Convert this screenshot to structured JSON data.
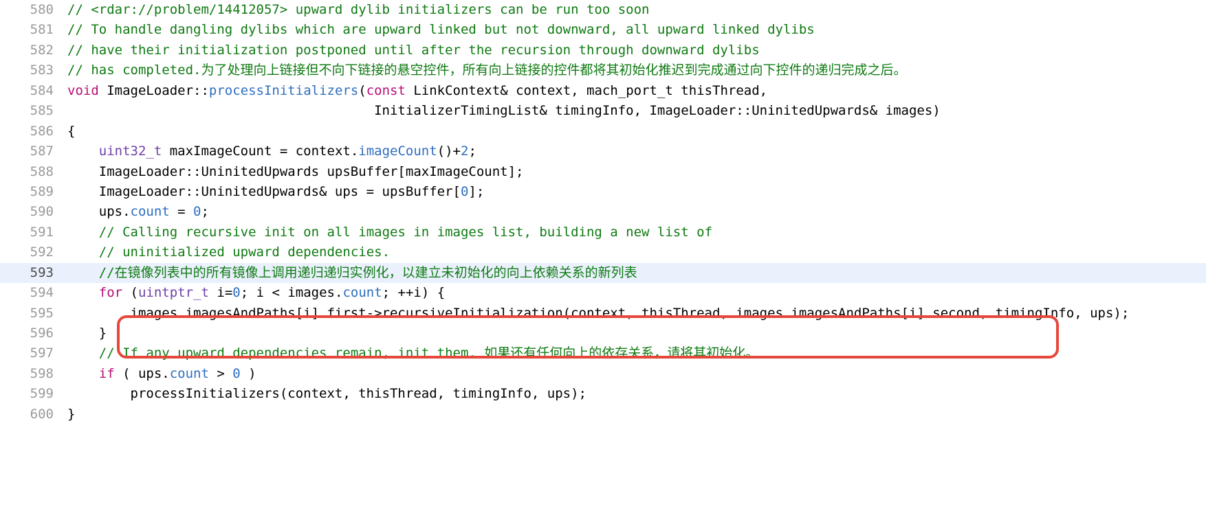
{
  "lines": [
    {
      "num": "580",
      "highlighted": false,
      "tokens": [
        {
          "cls": "tok-comment",
          "t": "// <rdar://problem/14412057> upward dylib initializers can be run too soon"
        }
      ]
    },
    {
      "num": "581",
      "highlighted": false,
      "tokens": [
        {
          "cls": "tok-comment",
          "t": "// To handle dangling dylibs which are upward linked but not downward, all upward linked dylibs"
        }
      ]
    },
    {
      "num": "582",
      "highlighted": false,
      "tokens": [
        {
          "cls": "tok-comment",
          "t": "// have their initialization postponed until after the recursion through downward dylibs"
        }
      ]
    },
    {
      "num": "583",
      "highlighted": false,
      "tokens": [
        {
          "cls": "tok-comment",
          "t": "// has completed.为了处理向上链接但不向下链接的悬空控件，所有向上链接的控件都将其初始化推迟到完成通过向下控件的递归完成之后。"
        }
      ]
    },
    {
      "num": "584",
      "highlighted": false,
      "tokens": [
        {
          "cls": "tok-keyword",
          "t": "void"
        },
        {
          "cls": "tok-plain",
          "t": " ImageLoader::"
        },
        {
          "cls": "tok-member",
          "t": "processInitializers"
        },
        {
          "cls": "tok-plain",
          "t": "("
        },
        {
          "cls": "tok-keyword",
          "t": "const"
        },
        {
          "cls": "tok-plain",
          "t": " LinkContext& context, mach_port_t thisThread,"
        }
      ]
    },
    {
      "num": "585",
      "highlighted": false,
      "tokens": [
        {
          "cls": "tok-plain",
          "t": "                                       InitializerTimingList& timingInfo, ImageLoader::UninitedUpwards& images)"
        }
      ]
    },
    {
      "num": "586",
      "highlighted": false,
      "tokens": [
        {
          "cls": "tok-plain",
          "t": "{"
        }
      ]
    },
    {
      "num": "587",
      "highlighted": false,
      "tokens": [
        {
          "cls": "tok-plain",
          "t": "    "
        },
        {
          "cls": "tok-type",
          "t": "uint32_t"
        },
        {
          "cls": "tok-plain",
          "t": " maxImageCount = context."
        },
        {
          "cls": "tok-member",
          "t": "imageCount"
        },
        {
          "cls": "tok-plain",
          "t": "()+"
        },
        {
          "cls": "tok-number",
          "t": "2"
        },
        {
          "cls": "tok-plain",
          "t": ";"
        }
      ]
    },
    {
      "num": "588",
      "highlighted": false,
      "tokens": [
        {
          "cls": "tok-plain",
          "t": "    ImageLoader::UninitedUpwards upsBuffer[maxImageCount];"
        }
      ]
    },
    {
      "num": "589",
      "highlighted": false,
      "tokens": [
        {
          "cls": "tok-plain",
          "t": "    ImageLoader::UninitedUpwards& ups = upsBuffer["
        },
        {
          "cls": "tok-number",
          "t": "0"
        },
        {
          "cls": "tok-plain",
          "t": "];"
        }
      ]
    },
    {
      "num": "590",
      "highlighted": false,
      "tokens": [
        {
          "cls": "tok-plain",
          "t": "    ups."
        },
        {
          "cls": "tok-member",
          "t": "count"
        },
        {
          "cls": "tok-plain",
          "t": " = "
        },
        {
          "cls": "tok-number",
          "t": "0"
        },
        {
          "cls": "tok-plain",
          "t": ";"
        }
      ]
    },
    {
      "num": "591",
      "highlighted": false,
      "tokens": [
        {
          "cls": "tok-plain",
          "t": "    "
        },
        {
          "cls": "tok-comment",
          "t": "// Calling recursive init on all images in images list, building a new list of"
        }
      ]
    },
    {
      "num": "592",
      "highlighted": false,
      "tokens": [
        {
          "cls": "tok-plain",
          "t": "    "
        },
        {
          "cls": "tok-comment",
          "t": "// uninitialized upward dependencies."
        }
      ]
    },
    {
      "num": "593",
      "highlighted": true,
      "tokens": [
        {
          "cls": "tok-plain",
          "t": "    "
        },
        {
          "cls": "tok-comment",
          "t": "//在镜像列表中的所有镜像上调用递归递归实例化，以建立未初始化的向上依赖关系的新列表"
        }
      ]
    },
    {
      "num": "594",
      "highlighted": false,
      "tokens": [
        {
          "cls": "tok-plain",
          "t": "    "
        },
        {
          "cls": "tok-keyword",
          "t": "for"
        },
        {
          "cls": "tok-plain",
          "t": " ("
        },
        {
          "cls": "tok-type",
          "t": "uintptr_t"
        },
        {
          "cls": "tok-plain",
          "t": " i="
        },
        {
          "cls": "tok-number",
          "t": "0"
        },
        {
          "cls": "tok-plain",
          "t": "; i < images."
        },
        {
          "cls": "tok-member",
          "t": "count"
        },
        {
          "cls": "tok-plain",
          "t": "; ++i) {"
        }
      ]
    },
    {
      "num": "595",
      "highlighted": false,
      "tokens": [
        {
          "cls": "tok-plain",
          "t": "        images.imagesAndPaths[i].first->recursiveInitialization(context, thisThread, images.imagesAndPaths[i].second, timingInfo, ups);"
        }
      ]
    },
    {
      "num": "596",
      "highlighted": false,
      "tokens": [
        {
          "cls": "tok-plain",
          "t": "    }"
        }
      ]
    },
    {
      "num": "597",
      "highlighted": false,
      "tokens": [
        {
          "cls": "tok-plain",
          "t": "    "
        },
        {
          "cls": "tok-comment",
          "t": "// If any upward dependencies remain, init them. 如果还有任何向上的依存关系，请将其初始化。"
        }
      ]
    },
    {
      "num": "598",
      "highlighted": false,
      "tokens": [
        {
          "cls": "tok-plain",
          "t": "    "
        },
        {
          "cls": "tok-keyword",
          "t": "if"
        },
        {
          "cls": "tok-plain",
          "t": " ( ups."
        },
        {
          "cls": "tok-member",
          "t": "count"
        },
        {
          "cls": "tok-plain",
          "t": " > "
        },
        {
          "cls": "tok-number",
          "t": "0"
        },
        {
          "cls": "tok-plain",
          "t": " )"
        }
      ]
    },
    {
      "num": "599",
      "highlighted": false,
      "tokens": [
        {
          "cls": "tok-plain",
          "t": "        processInitializers(context, thisThread, timingInfo, ups);"
        }
      ]
    },
    {
      "num": "600",
      "highlighted": false,
      "tokens": [
        {
          "cls": "tok-plain",
          "t": "}"
        }
      ]
    }
  ]
}
